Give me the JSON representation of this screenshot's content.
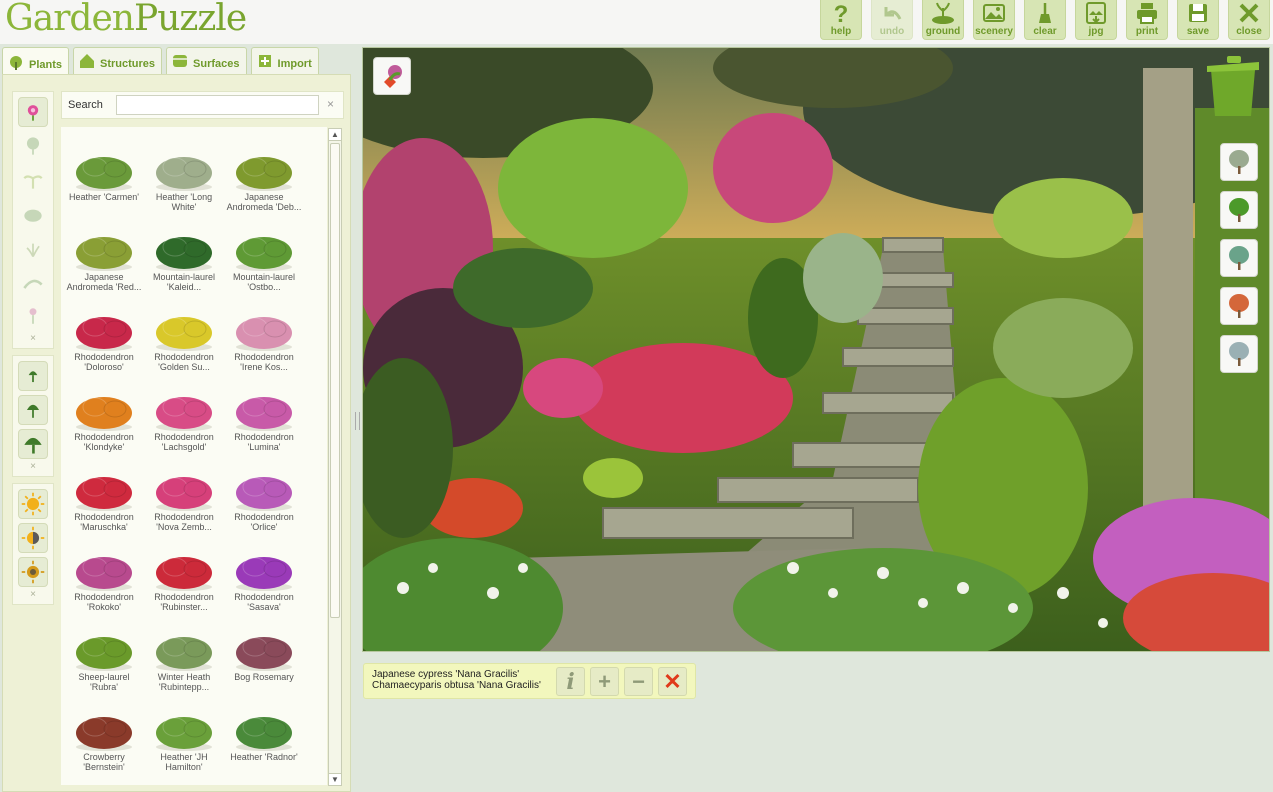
{
  "app": {
    "logo_a": "Garden",
    "logo_b": "Puzzle"
  },
  "toolbar": [
    {
      "label": "help",
      "icon": "help-icon",
      "enabled": true
    },
    {
      "label": "undo",
      "icon": "undo-icon",
      "enabled": false
    },
    {
      "label": "ground",
      "icon": "ground-icon",
      "enabled": true
    },
    {
      "label": "scenery",
      "icon": "scenery-icon",
      "enabled": true
    },
    {
      "label": "clear",
      "icon": "clear-icon",
      "enabled": true
    },
    {
      "label": "jpg",
      "icon": "jpg-icon",
      "enabled": true
    },
    {
      "label": "print",
      "icon": "print-icon",
      "enabled": true
    },
    {
      "label": "save",
      "icon": "save-icon",
      "enabled": true
    },
    {
      "label": "close",
      "icon": "close-icon",
      "enabled": true
    }
  ],
  "tabs": [
    {
      "label": "Plants",
      "icon": "plants-icon",
      "active": true
    },
    {
      "label": "Structures",
      "icon": "house-icon",
      "active": false
    },
    {
      "label": "Surfaces",
      "icon": "surface-icon",
      "active": false
    },
    {
      "label": "Import",
      "icon": "import-icon",
      "active": false
    }
  ],
  "search": {
    "label": "Search",
    "value": "",
    "placeholder": "",
    "clear": "×"
  },
  "filters": {
    "type": [
      "flower-icon",
      "tree-icon",
      "palm-icon",
      "shrub-icon",
      "grass-icon",
      "fern-icon",
      "bulb-icon"
    ],
    "size": [
      "small-tree-icon",
      "medium-tree-icon",
      "large-tree-icon"
    ],
    "light": [
      "full-sun-icon",
      "part-shade-icon",
      "shade-icon"
    ],
    "clear": "×"
  },
  "plants": [
    {
      "name": "Heather 'Carmen'",
      "color": "#6a9a3a"
    },
    {
      "name": "Heather 'Long White'",
      "color": "#9fae8c"
    },
    {
      "name": "Japanese Andromeda 'Deb...",
      "color": "#7f9a2e"
    },
    {
      "name": "Japanese Andromeda 'Red...",
      "color": "#8a9f35"
    },
    {
      "name": "Mountain-laurel 'Kaleid...",
      "color": "#2f6a2a"
    },
    {
      "name": "Mountain-laurel 'Ostbo...",
      "color": "#5f9a35"
    },
    {
      "name": "Rhododendron 'Doloroso'",
      "color": "#c8284a"
    },
    {
      "name": "Rhododendron 'Golden Su...",
      "color": "#d9c82a"
    },
    {
      "name": "Rhododendron 'Irene Kos...",
      "color": "#d990b0"
    },
    {
      "name": "Rhododendron 'Klondyke'",
      "color": "#e0801e"
    },
    {
      "name": "Rhododendron 'Lachsgold'",
      "color": "#d84c86"
    },
    {
      "name": "Rhododendron 'Lumina'",
      "color": "#c85aa8"
    },
    {
      "name": "Rhododendron 'Maruschka'",
      "color": "#cf2a3e"
    },
    {
      "name": "Rhododendron 'Nova Zemb...",
      "color": "#d6407a"
    },
    {
      "name": "Rhododendron 'Orlice'",
      "color": "#b85ab8"
    },
    {
      "name": "Rhododendron 'Rokoko'",
      "color": "#b84a8e"
    },
    {
      "name": "Rhododendron 'Rubinster...",
      "color": "#cc2a3a"
    },
    {
      "name": "Rhododendron 'Sasava'",
      "color": "#9a3ab8"
    },
    {
      "name": "Sheep-laurel 'Rubra'",
      "color": "#6a9a2a"
    },
    {
      "name": "Winter Heath 'Rubintepp...",
      "color": "#7a9a5a"
    },
    {
      "name": "Bog Rosemary",
      "color": "#8a4a5a"
    },
    {
      "name": "Crowberry 'Bernstein'",
      "color": "#8a3a2a"
    },
    {
      "name": "Heather 'JH Hamilton'",
      "color": "#6aa03a"
    },
    {
      "name": "Heather 'Radnor'",
      "color": "#4a8a3a"
    }
  ],
  "canvas": {
    "layers_button": "layers-icon",
    "trash": "trash-icon",
    "view_buttons": [
      "view-tree-outline-icon",
      "view-tree-green-icon",
      "view-tree-teal-icon",
      "view-tree-autumn-icon",
      "view-tree-winter-icon"
    ]
  },
  "selected_plant": {
    "common_name": "Japanese cypress 'Nana Gracilis'",
    "botanical_name": "Chamaecyparis obtusa 'Nana Gracilis'",
    "info": "i",
    "plus": "+",
    "minus": "−",
    "remove": "✕"
  }
}
